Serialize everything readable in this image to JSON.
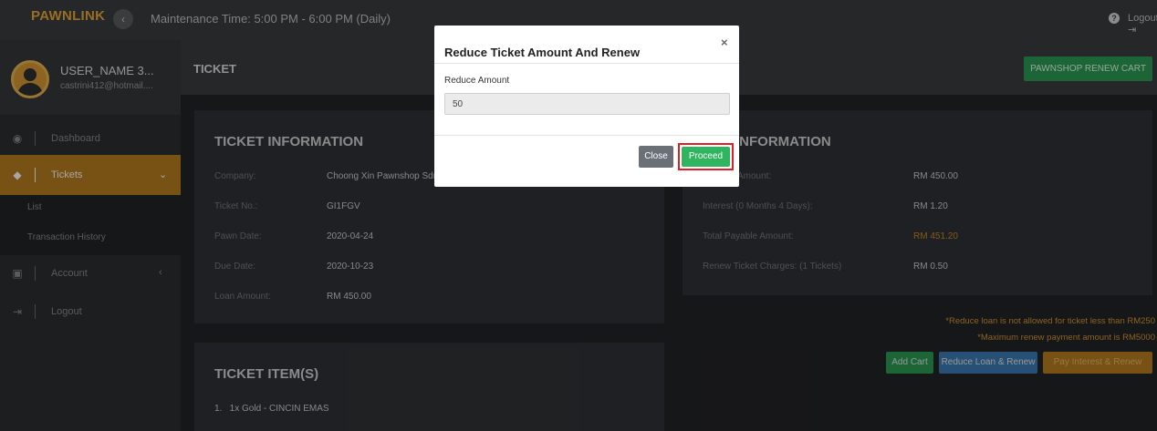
{
  "topbar": {
    "brand": "PAWNLINK",
    "collapse_icon": "chevron-left-icon",
    "maintenance": "Maintenance Time: 5:00 PM - 6:00 PM (Daily)",
    "help_icon": "question-circle-icon",
    "logout": "Logout"
  },
  "user": {
    "name": "USER_NAME 3...",
    "email": "castrini412@hotmail...."
  },
  "sidebar": {
    "items": [
      {
        "label": "Dashboard",
        "icon": "dashboard-icon"
      },
      {
        "label": "Tickets",
        "icon": "tag-icon",
        "active": true
      },
      {
        "label": "Account",
        "icon": "id-card-icon"
      },
      {
        "label": "Logout",
        "icon": "logout-icon"
      }
    ],
    "tickets_sub": [
      "List",
      "Transaction History"
    ]
  },
  "header": {
    "title": "TICKET",
    "cart_button": "PAWNSHOP RENEW CART"
  },
  "ticket_info": {
    "title": "TICKET INFORMATION",
    "rows": [
      {
        "label": "Company:",
        "value": "Choong Xin Pawnshop Sdn"
      },
      {
        "label": "Ticket No.:",
        "value": "GI1FGV"
      },
      {
        "label": "Pawn Date:",
        "value": "2020-04-24"
      },
      {
        "label": "Due Date:",
        "value": "2020-10-23"
      },
      {
        "label": "Loan Amount:",
        "value": "RM 450.00"
      }
    ]
  },
  "renew_info": {
    "title": "INFORMATION",
    "rows": [
      {
        "label": "Amount:",
        "value": "RM 450.00"
      },
      {
        "label": "Interest (0 Months 4 Days):",
        "value": "RM 1.20"
      },
      {
        "label": "Total Payable Amount:",
        "value": "RM 451.20"
      },
      {
        "label": "Renew Ticket Charges: (1 Tickets)",
        "value": "RM 0.50"
      }
    ],
    "note1": "*Reduce loan is not allowed for ticket less than RM250",
    "note2": "*Maximum renew payment amount is RM5000",
    "buttons": {
      "add_cart": "Add Cart",
      "reduce": "Reduce Loan & Renew",
      "pay": "Pay Interest & Renew"
    },
    "colors": {
      "add_cart": "#2a9c55",
      "reduce": "#3d7bb5",
      "pay": "#b87d1f"
    }
  },
  "ticket_items": {
    "title": "TICKET ITEM(S)",
    "items": [
      "1.   1x Gold - CINCIN EMAS"
    ]
  },
  "modal": {
    "title": "Reduce Ticket Amount And Renew",
    "close_icon": "close-icon",
    "field_label": "Reduce Amount",
    "field_value": "50",
    "close_button": "Close",
    "proceed_button": "Proceed"
  }
}
